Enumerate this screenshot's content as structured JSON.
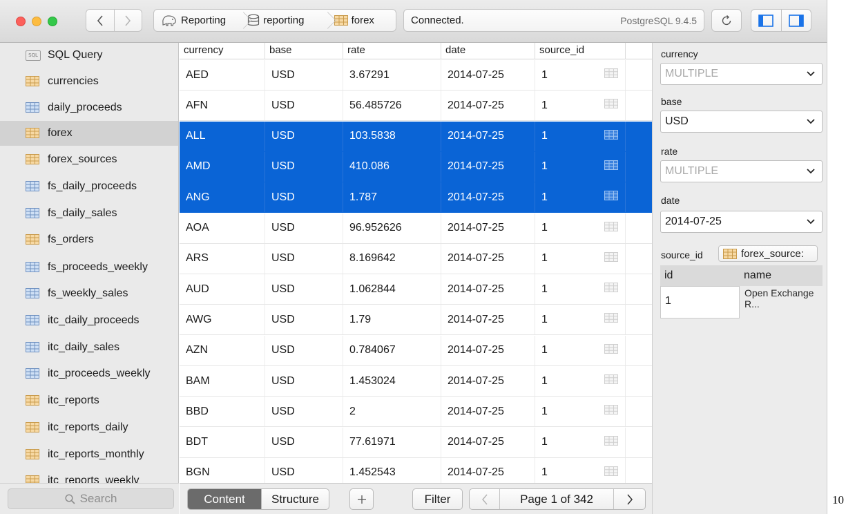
{
  "toolbar": {
    "breadcrumbs": [
      "Reporting",
      "reporting",
      "forex"
    ],
    "status": "Connected.",
    "server": "PostgreSQL 9.4.5"
  },
  "sidebar": {
    "items": [
      {
        "label": "SQL Query",
        "kind": "sql"
      },
      {
        "label": "currencies",
        "kind": "table-icon"
      },
      {
        "label": "daily_proceeds",
        "kind": "view-icon"
      },
      {
        "label": "forex",
        "kind": "table-icon"
      },
      {
        "label": "forex_sources",
        "kind": "table-icon"
      },
      {
        "label": "fs_daily_proceeds",
        "kind": "view-icon"
      },
      {
        "label": "fs_daily_sales",
        "kind": "view-icon"
      },
      {
        "label": "fs_orders",
        "kind": "table-icon"
      },
      {
        "label": "fs_proceeds_weekly",
        "kind": "view-icon"
      },
      {
        "label": "fs_weekly_sales",
        "kind": "view-icon"
      },
      {
        "label": "itc_daily_proceeds",
        "kind": "view-icon"
      },
      {
        "label": "itc_daily_sales",
        "kind": "view-icon"
      },
      {
        "label": "itc_proceeds_weekly",
        "kind": "view-icon"
      },
      {
        "label": "itc_reports",
        "kind": "table-icon"
      },
      {
        "label": "itc_reports_daily",
        "kind": "table-icon"
      },
      {
        "label": "itc_reports_monthly",
        "kind": "table-icon"
      },
      {
        "label": "itc_reports_weekly",
        "kind": "table-icon"
      }
    ],
    "selected": "forex",
    "search_placeholder": "Search"
  },
  "table": {
    "columns": [
      "currency",
      "base",
      "rate",
      "date",
      "source_id"
    ],
    "rows": [
      [
        "AED",
        "USD",
        "3.67291",
        "2014-07-25",
        "1"
      ],
      [
        "AFN",
        "USD",
        "56.485726",
        "2014-07-25",
        "1"
      ],
      [
        "ALL",
        "USD",
        "103.5838",
        "2014-07-25",
        "1"
      ],
      [
        "AMD",
        "USD",
        "410.086",
        "2014-07-25",
        "1"
      ],
      [
        "ANG",
        "USD",
        "1.787",
        "2014-07-25",
        "1"
      ],
      [
        "AOA",
        "USD",
        "96.952626",
        "2014-07-25",
        "1"
      ],
      [
        "ARS",
        "USD",
        "8.169642",
        "2014-07-25",
        "1"
      ],
      [
        "AUD",
        "USD",
        "1.062844",
        "2014-07-25",
        "1"
      ],
      [
        "AWG",
        "USD",
        "1.79",
        "2014-07-25",
        "1"
      ],
      [
        "AZN",
        "USD",
        "0.784067",
        "2014-07-25",
        "1"
      ],
      [
        "BAM",
        "USD",
        "1.453024",
        "2014-07-25",
        "1"
      ],
      [
        "BBD",
        "USD",
        "2",
        "2014-07-25",
        "1"
      ],
      [
        "BDT",
        "USD",
        "77.61971",
        "2014-07-25",
        "1"
      ],
      [
        "BGN",
        "USD",
        "1.452543",
        "2014-07-25",
        "1"
      ]
    ],
    "selected_rows": [
      2,
      3,
      4
    ]
  },
  "bottom_bar": {
    "tab_content": "Content",
    "tab_structure": "Structure",
    "filter": "Filter",
    "page": "Page 1 of 342"
  },
  "detail": {
    "fields": [
      {
        "label": "currency",
        "value": "MULTIPLE",
        "placeholder": true
      },
      {
        "label": "base",
        "value": "USD",
        "placeholder": false
      },
      {
        "label": "rate",
        "value": "MULTIPLE",
        "placeholder": true
      },
      {
        "label": "date",
        "value": "2014-07-25",
        "placeholder": false
      }
    ],
    "fk_label": "source_id",
    "fk_table": "forex_source:",
    "fk_columns": [
      "id",
      "name"
    ],
    "fk_row": {
      "id": "1",
      "name": "Open Exchange R..."
    }
  },
  "edge_text": "10",
  "colors": {
    "selection": "#0a64d6",
    "sidebar": "#eaeaea",
    "accent_blue": "#1a73e8"
  }
}
